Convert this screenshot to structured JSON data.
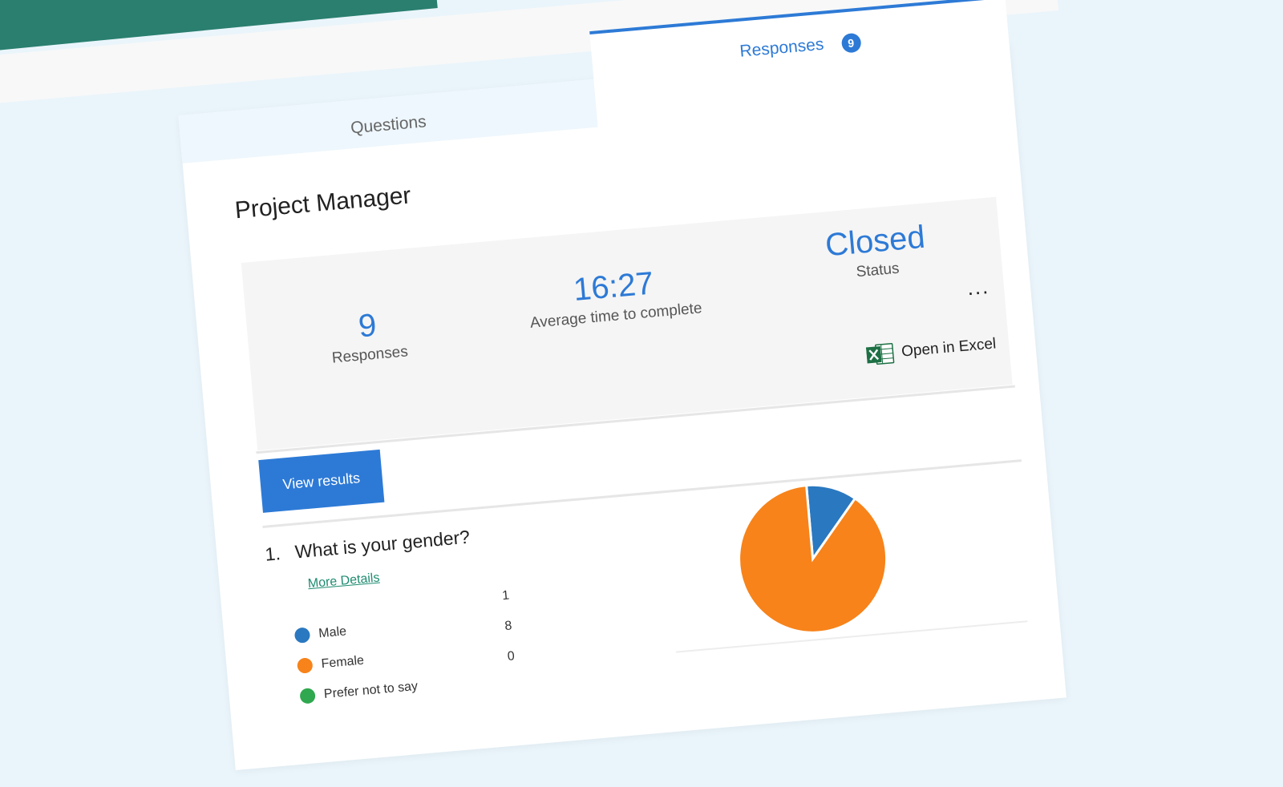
{
  "tabs": {
    "questions_label": "Questions",
    "responses_label": "Responses",
    "responses_badge": "9"
  },
  "form": {
    "title": "Project Manager"
  },
  "summary": {
    "responses_value": "9",
    "responses_label": "Responses",
    "avg_time_value": "16:27",
    "avg_time_label": "Average time to complete",
    "status_value": "Closed",
    "status_label": "Status",
    "more_label": "...",
    "open_excel_label": "Open in Excel"
  },
  "actions": {
    "view_results_label": "View results"
  },
  "question1": {
    "number": "1.",
    "text": "What is your gender?",
    "more_details_label": "More Details",
    "options": [
      {
        "label": "Male",
        "count": "1",
        "color": "#2a78c0"
      },
      {
        "label": "Female",
        "count": "8",
        "color": "#f7831a"
      },
      {
        "label": "Prefer not to say",
        "count": "0",
        "color": "#2fa84f"
      }
    ]
  },
  "chart_data": {
    "type": "pie",
    "categories": [
      "Male",
      "Female",
      "Prefer not to say"
    ],
    "values": [
      1,
      8,
      0
    ],
    "colors": [
      "#2a78c0",
      "#f7831a",
      "#2fa84f"
    ]
  },
  "colors": {
    "accent": "#2d7ad6",
    "banner": "#2a7f6f",
    "background": "#eaf5fb",
    "link": "#1e8c70"
  }
}
